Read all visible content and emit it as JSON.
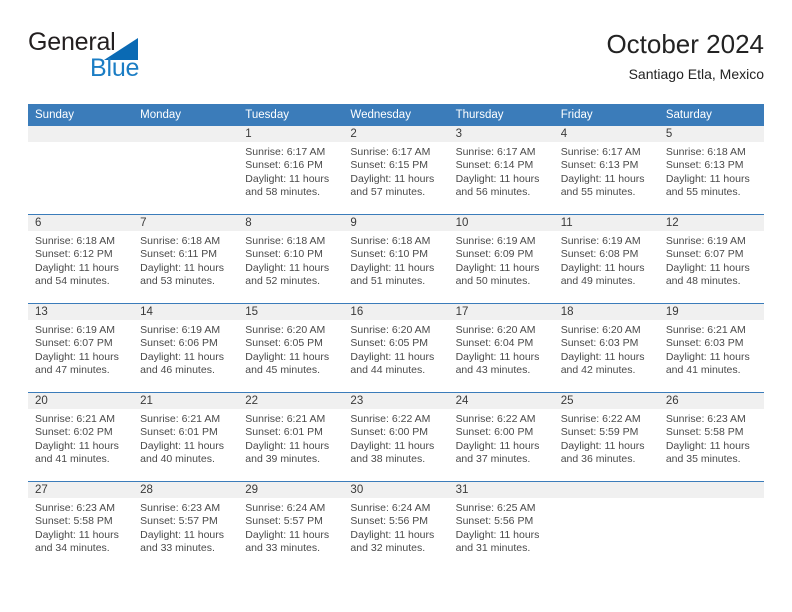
{
  "brand": {
    "name_top": "General",
    "name_bottom": "Blue"
  },
  "header": {
    "title": "October 2024",
    "subtitle": "Santiago Etla, Mexico"
  },
  "calendar": {
    "weekdays": [
      "Sunday",
      "Monday",
      "Tuesday",
      "Wednesday",
      "Thursday",
      "Friday",
      "Saturday"
    ],
    "colors": {
      "header_blue": "#3b7cba",
      "day_band_gray": "#f0f0f0",
      "brand_blue": "#1b7dc4",
      "logo_triangle_blue": "#0a6ab4"
    },
    "weeks": [
      [
        {
          "day": "",
          "sunrise": "",
          "sunset": "",
          "daylight1": "",
          "daylight2": ""
        },
        {
          "day": "",
          "sunrise": "",
          "sunset": "",
          "daylight1": "",
          "daylight2": ""
        },
        {
          "day": "1",
          "sunrise": "Sunrise: 6:17 AM",
          "sunset": "Sunset: 6:16 PM",
          "daylight1": "Daylight: 11 hours",
          "daylight2": "and 58 minutes."
        },
        {
          "day": "2",
          "sunrise": "Sunrise: 6:17 AM",
          "sunset": "Sunset: 6:15 PM",
          "daylight1": "Daylight: 11 hours",
          "daylight2": "and 57 minutes."
        },
        {
          "day": "3",
          "sunrise": "Sunrise: 6:17 AM",
          "sunset": "Sunset: 6:14 PM",
          "daylight1": "Daylight: 11 hours",
          "daylight2": "and 56 minutes."
        },
        {
          "day": "4",
          "sunrise": "Sunrise: 6:17 AM",
          "sunset": "Sunset: 6:13 PM",
          "daylight1": "Daylight: 11 hours",
          "daylight2": "and 55 minutes."
        },
        {
          "day": "5",
          "sunrise": "Sunrise: 6:18 AM",
          "sunset": "Sunset: 6:13 PM",
          "daylight1": "Daylight: 11 hours",
          "daylight2": "and 55 minutes."
        }
      ],
      [
        {
          "day": "6",
          "sunrise": "Sunrise: 6:18 AM",
          "sunset": "Sunset: 6:12 PM",
          "daylight1": "Daylight: 11 hours",
          "daylight2": "and 54 minutes."
        },
        {
          "day": "7",
          "sunrise": "Sunrise: 6:18 AM",
          "sunset": "Sunset: 6:11 PM",
          "daylight1": "Daylight: 11 hours",
          "daylight2": "and 53 minutes."
        },
        {
          "day": "8",
          "sunrise": "Sunrise: 6:18 AM",
          "sunset": "Sunset: 6:10 PM",
          "daylight1": "Daylight: 11 hours",
          "daylight2": "and 52 minutes."
        },
        {
          "day": "9",
          "sunrise": "Sunrise: 6:18 AM",
          "sunset": "Sunset: 6:10 PM",
          "daylight1": "Daylight: 11 hours",
          "daylight2": "and 51 minutes."
        },
        {
          "day": "10",
          "sunrise": "Sunrise: 6:19 AM",
          "sunset": "Sunset: 6:09 PM",
          "daylight1": "Daylight: 11 hours",
          "daylight2": "and 50 minutes."
        },
        {
          "day": "11",
          "sunrise": "Sunrise: 6:19 AM",
          "sunset": "Sunset: 6:08 PM",
          "daylight1": "Daylight: 11 hours",
          "daylight2": "and 49 minutes."
        },
        {
          "day": "12",
          "sunrise": "Sunrise: 6:19 AM",
          "sunset": "Sunset: 6:07 PM",
          "daylight1": "Daylight: 11 hours",
          "daylight2": "and 48 minutes."
        }
      ],
      [
        {
          "day": "13",
          "sunrise": "Sunrise: 6:19 AM",
          "sunset": "Sunset: 6:07 PM",
          "daylight1": "Daylight: 11 hours",
          "daylight2": "and 47 minutes."
        },
        {
          "day": "14",
          "sunrise": "Sunrise: 6:19 AM",
          "sunset": "Sunset: 6:06 PM",
          "daylight1": "Daylight: 11 hours",
          "daylight2": "and 46 minutes."
        },
        {
          "day": "15",
          "sunrise": "Sunrise: 6:20 AM",
          "sunset": "Sunset: 6:05 PM",
          "daylight1": "Daylight: 11 hours",
          "daylight2": "and 45 minutes."
        },
        {
          "day": "16",
          "sunrise": "Sunrise: 6:20 AM",
          "sunset": "Sunset: 6:05 PM",
          "daylight1": "Daylight: 11 hours",
          "daylight2": "and 44 minutes."
        },
        {
          "day": "17",
          "sunrise": "Sunrise: 6:20 AM",
          "sunset": "Sunset: 6:04 PM",
          "daylight1": "Daylight: 11 hours",
          "daylight2": "and 43 minutes."
        },
        {
          "day": "18",
          "sunrise": "Sunrise: 6:20 AM",
          "sunset": "Sunset: 6:03 PM",
          "daylight1": "Daylight: 11 hours",
          "daylight2": "and 42 minutes."
        },
        {
          "day": "19",
          "sunrise": "Sunrise: 6:21 AM",
          "sunset": "Sunset: 6:03 PM",
          "daylight1": "Daylight: 11 hours",
          "daylight2": "and 41 minutes."
        }
      ],
      [
        {
          "day": "20",
          "sunrise": "Sunrise: 6:21 AM",
          "sunset": "Sunset: 6:02 PM",
          "daylight1": "Daylight: 11 hours",
          "daylight2": "and 41 minutes."
        },
        {
          "day": "21",
          "sunrise": "Sunrise: 6:21 AM",
          "sunset": "Sunset: 6:01 PM",
          "daylight1": "Daylight: 11 hours",
          "daylight2": "and 40 minutes."
        },
        {
          "day": "22",
          "sunrise": "Sunrise: 6:21 AM",
          "sunset": "Sunset: 6:01 PM",
          "daylight1": "Daylight: 11 hours",
          "daylight2": "and 39 minutes."
        },
        {
          "day": "23",
          "sunrise": "Sunrise: 6:22 AM",
          "sunset": "Sunset: 6:00 PM",
          "daylight1": "Daylight: 11 hours",
          "daylight2": "and 38 minutes."
        },
        {
          "day": "24",
          "sunrise": "Sunrise: 6:22 AM",
          "sunset": "Sunset: 6:00 PM",
          "daylight1": "Daylight: 11 hours",
          "daylight2": "and 37 minutes."
        },
        {
          "day": "25",
          "sunrise": "Sunrise: 6:22 AM",
          "sunset": "Sunset: 5:59 PM",
          "daylight1": "Daylight: 11 hours",
          "daylight2": "and 36 minutes."
        },
        {
          "day": "26",
          "sunrise": "Sunrise: 6:23 AM",
          "sunset": "Sunset: 5:58 PM",
          "daylight1": "Daylight: 11 hours",
          "daylight2": "and 35 minutes."
        }
      ],
      [
        {
          "day": "27",
          "sunrise": "Sunrise: 6:23 AM",
          "sunset": "Sunset: 5:58 PM",
          "daylight1": "Daylight: 11 hours",
          "daylight2": "and 34 minutes."
        },
        {
          "day": "28",
          "sunrise": "Sunrise: 6:23 AM",
          "sunset": "Sunset: 5:57 PM",
          "daylight1": "Daylight: 11 hours",
          "daylight2": "and 33 minutes."
        },
        {
          "day": "29",
          "sunrise": "Sunrise: 6:24 AM",
          "sunset": "Sunset: 5:57 PM",
          "daylight1": "Daylight: 11 hours",
          "daylight2": "and 33 minutes."
        },
        {
          "day": "30",
          "sunrise": "Sunrise: 6:24 AM",
          "sunset": "Sunset: 5:56 PM",
          "daylight1": "Daylight: 11 hours",
          "daylight2": "and 32 minutes."
        },
        {
          "day": "31",
          "sunrise": "Sunrise: 6:25 AM",
          "sunset": "Sunset: 5:56 PM",
          "daylight1": "Daylight: 11 hours",
          "daylight2": "and 31 minutes."
        },
        {
          "day": "",
          "sunrise": "",
          "sunset": "",
          "daylight1": "",
          "daylight2": ""
        },
        {
          "day": "",
          "sunrise": "",
          "sunset": "",
          "daylight1": "",
          "daylight2": ""
        }
      ]
    ]
  }
}
